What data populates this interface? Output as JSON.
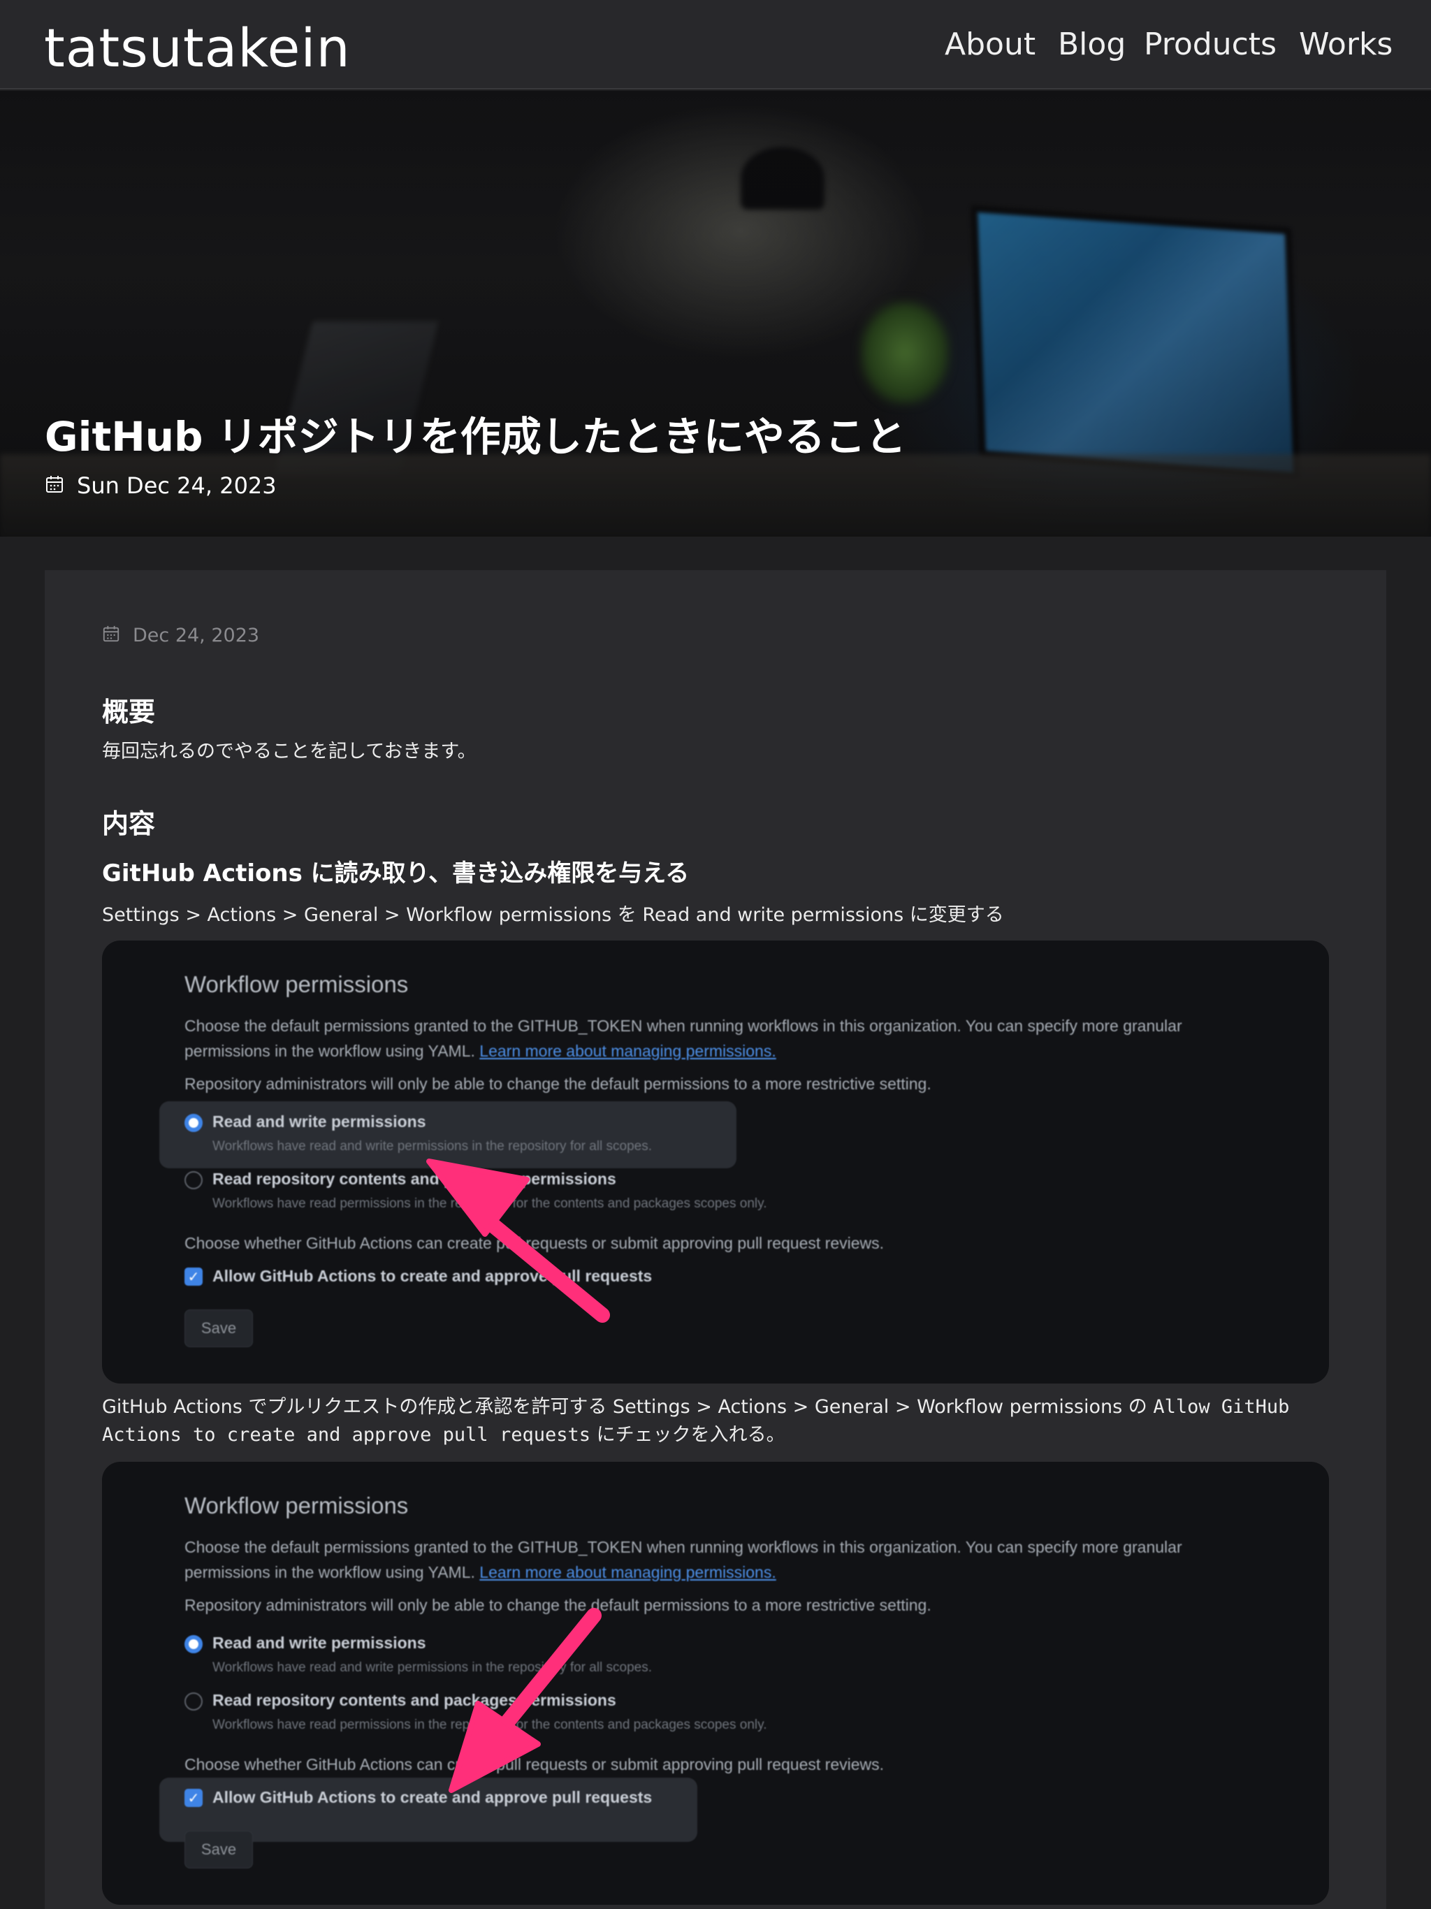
{
  "nav": {
    "brand": "tatsutakein",
    "links": [
      "About",
      "Blog",
      "Products",
      "Works"
    ]
  },
  "hero": {
    "title": "GitHub リポジトリを作成したときにやること",
    "date": "Sun Dec 24, 2023"
  },
  "article": {
    "date": "Dec 24, 2023",
    "h_overview": "概要",
    "overview_text": "毎回忘れるのでやることを記しておきます。",
    "h_contents": "内容",
    "h_actions": "GitHub Actions に読み取り、書き込み権限を与える",
    "actions_text": "Settings > Actions > General > Workflow permissions を Read and write permissions に変更する",
    "pr_text_1": "GitHub Actions でプルリクエストの作成と承認を許可する Settings > Actions > General > Workflow permissions の ",
    "pr_code": "Allow GitHub Actions to create and approve pull requests",
    "pr_text_2": " にチェックを入れる。"
  },
  "screenshot": {
    "title": "Workflow permissions",
    "desc_line1": "Choose the default permissions granted to the GITHUB_TOKEN when running workflows in this organization. You can specify more granular",
    "desc_line2": "permissions in the workflow using YAML.",
    "learn_more": "Learn more about managing permissions.",
    "note": "Repository administrators will only be able to change the default permissions to a more restrictive setting.",
    "opt1_label": "Read and write permissions",
    "opt1_sub": "Workflows have read and write permissions in the repository for all scopes.",
    "opt2_label": "Read repository contents and packages permissions",
    "opt2_sub": "Workflows have read permissions in the repository for the contents and packages scopes only.",
    "choose": "Choose whether GitHub Actions can create pull requests or submit approving pull request reviews.",
    "checkbox_label": "Allow GitHub Actions to create and approve pull requests",
    "checkbox_glyph": "✓",
    "save": "Save"
  },
  "colors": {
    "accent_arrow": "#ff2f7a",
    "radio_blue": "#3f84e6"
  },
  "icons": {
    "date": "calendar-icon",
    "arrow": "arrow-annotation"
  }
}
